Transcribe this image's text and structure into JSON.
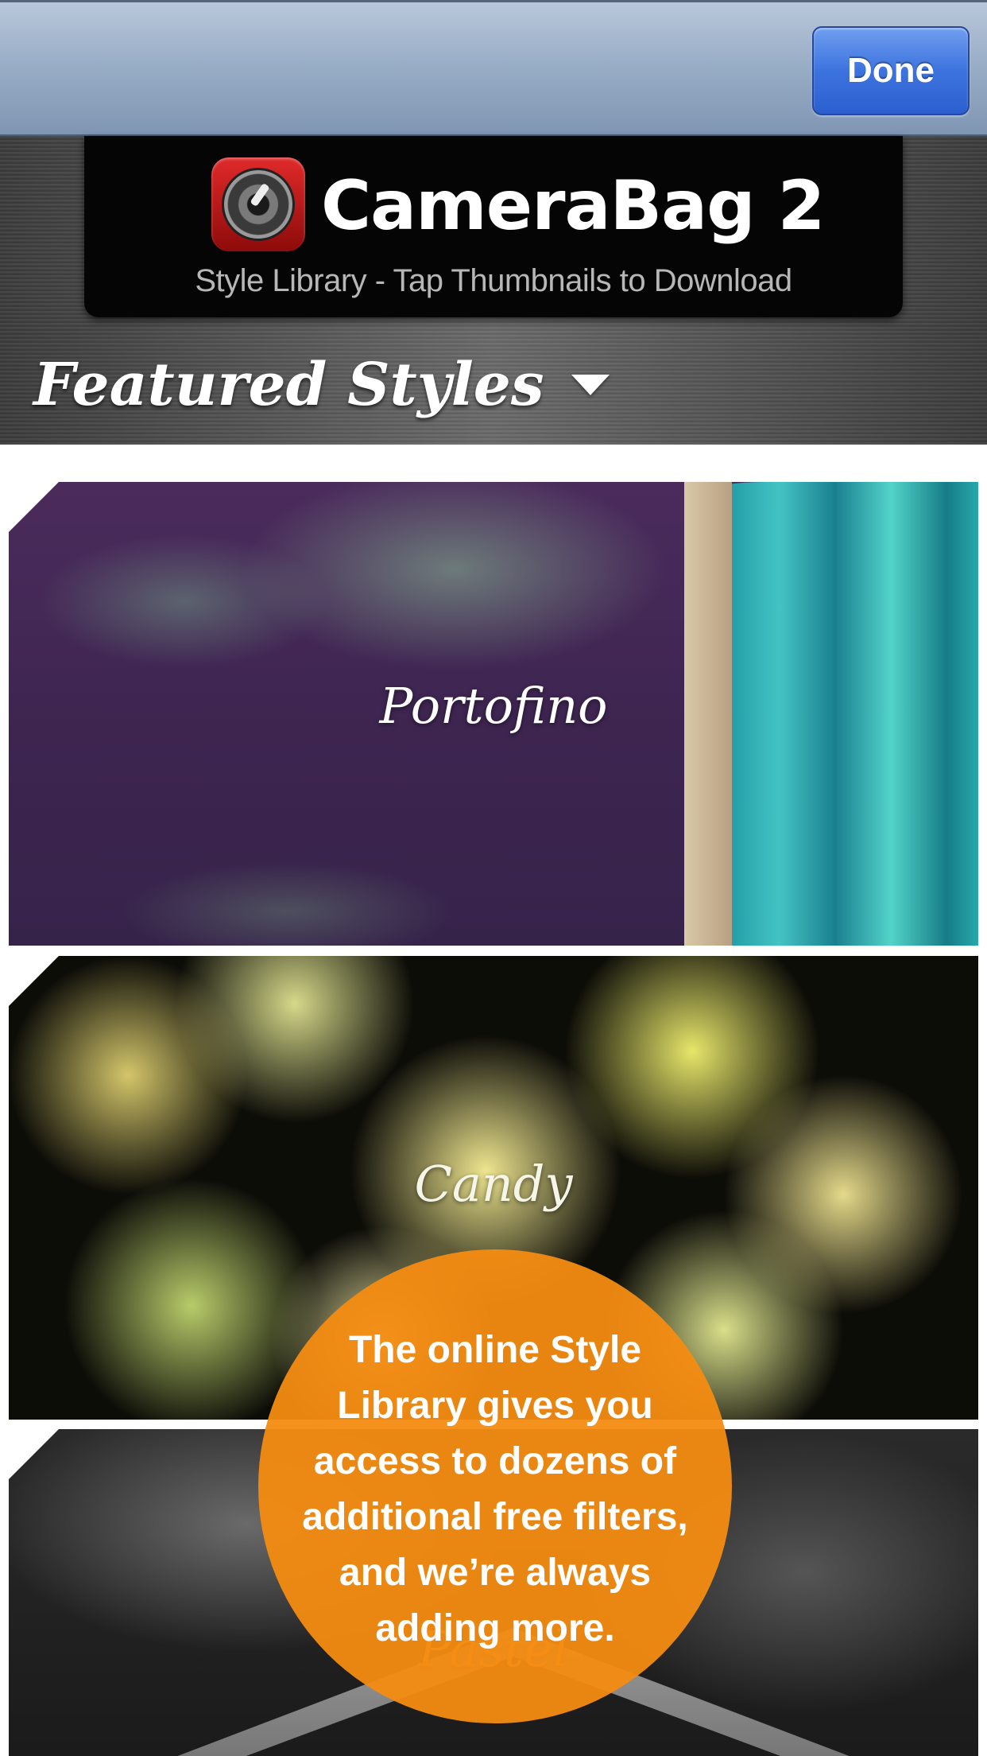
{
  "navbar": {
    "done_label": "Done"
  },
  "header": {
    "app_name": "CameraBag 2",
    "subtitle": "Style Library - Tap Thumbnails to Download",
    "section_title": "Featured Styles"
  },
  "styles": [
    {
      "name": "Portofino"
    },
    {
      "name": "Candy"
    },
    {
      "name": "Pastel"
    }
  ],
  "promo": {
    "text": "The online Style Library gives you access to dozens of additional free filters, and we’re always adding more."
  },
  "colors": {
    "promo_orange": "#F48C12",
    "done_blue": "#3D73DE"
  },
  "icons": {
    "app_icon": "camera-lens-icon",
    "dropdown": "caret-down-icon"
  }
}
